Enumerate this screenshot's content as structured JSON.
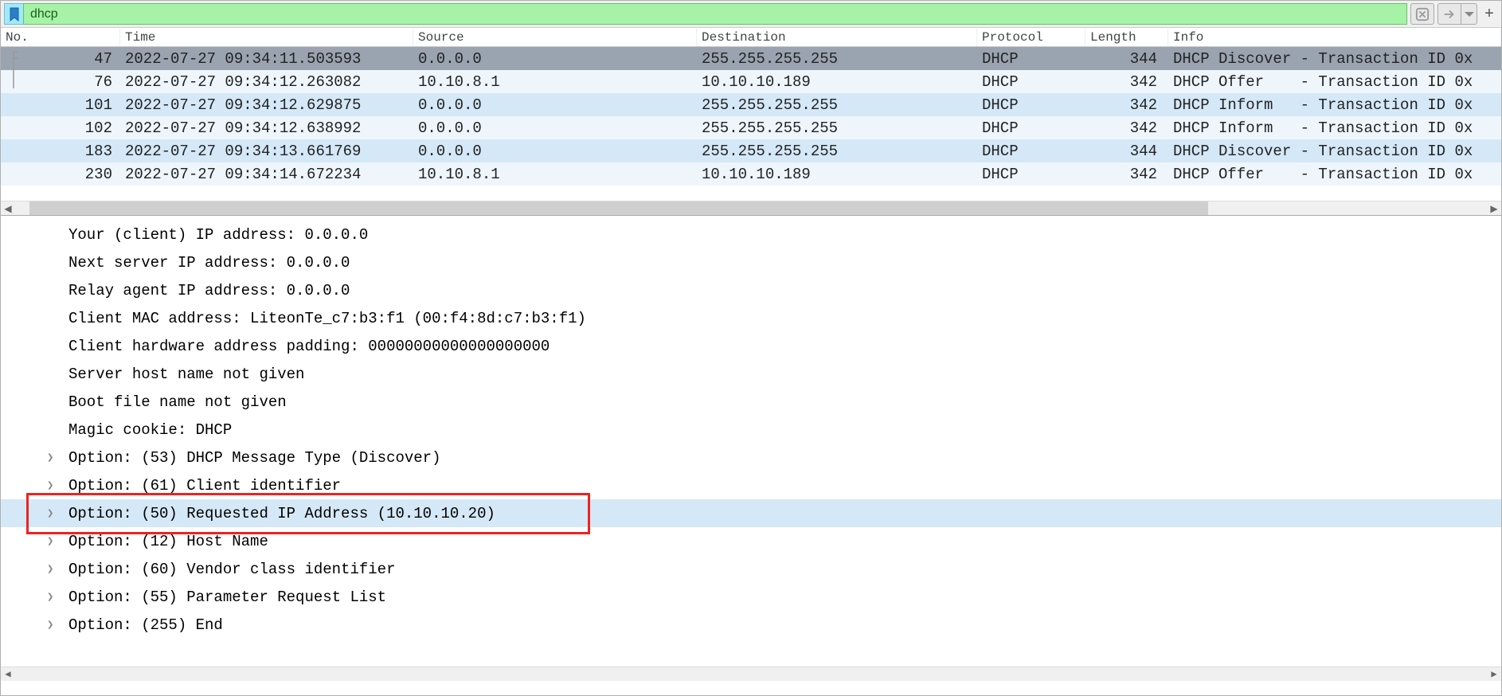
{
  "filter": {
    "value": "dhcp"
  },
  "columns": {
    "no": "No.",
    "time": "Time",
    "source": "Source",
    "destination": "Destination",
    "protocol": "Protocol",
    "length": "Length",
    "info": "Info"
  },
  "packets": [
    {
      "no": "47",
      "time": "2022-07-27 09:34:11.503593",
      "src": "0.0.0.0",
      "dst": "255.255.255.255",
      "proto": "DHCP",
      "len": "344",
      "info": "DHCP Discover - Transaction ID 0x",
      "sel": true
    },
    {
      "no": "76",
      "time": "2022-07-27 09:34:12.263082",
      "src": "10.10.8.1",
      "dst": "10.10.10.189",
      "proto": "DHCP",
      "len": "342",
      "info": "DHCP Offer    - Transaction ID 0x",
      "cls": "light"
    },
    {
      "no": "101",
      "time": "2022-07-27 09:34:12.629875",
      "src": "0.0.0.0",
      "dst": "255.255.255.255",
      "proto": "DHCP",
      "len": "342",
      "info": "DHCP Inform   - Transaction ID 0x",
      "cls": "alt"
    },
    {
      "no": "102",
      "time": "2022-07-27 09:34:12.638992",
      "src": "0.0.0.0",
      "dst": "255.255.255.255",
      "proto": "DHCP",
      "len": "342",
      "info": "DHCP Inform   - Transaction ID 0x",
      "cls": "light"
    },
    {
      "no": "183",
      "time": "2022-07-27 09:34:13.661769",
      "src": "0.0.0.0",
      "dst": "255.255.255.255",
      "proto": "DHCP",
      "len": "344",
      "info": "DHCP Discover - Transaction ID 0x",
      "cls": "alt"
    },
    {
      "no": "230",
      "time": "2022-07-27 09:34:14.672234",
      "src": "10.10.8.1",
      "dst": "10.10.10.189",
      "proto": "DHCP",
      "len": "342",
      "info": "DHCP Offer    - Transaction ID 0x",
      "cls": "light"
    }
  ],
  "details": {
    "your_ip": "Your (client) IP address: 0.0.0.0",
    "next_srv": "Next server IP address: 0.0.0.0",
    "relay": "Relay agent IP address: 0.0.0.0",
    "mac": "Client MAC address: LiteonTe_c7:b3:f1 (00:f4:8d:c7:b3:f1)",
    "hw_pad": "Client hardware address padding: 00000000000000000000",
    "srv_host": "Server host name not given",
    "boot": "Boot file name not given",
    "cookie": "Magic cookie: DHCP",
    "opt53": "Option: (53) DHCP Message Type (Discover)",
    "opt61": "Option: (61) Client identifier",
    "opt50": "Option: (50) Requested IP Address (10.10.10.20)",
    "opt12": "Option: (12) Host Name",
    "opt60": "Option: (60) Vendor class identifier",
    "opt55": "Option: (55) Parameter Request List",
    "opt255": "Option: (255) End"
  }
}
